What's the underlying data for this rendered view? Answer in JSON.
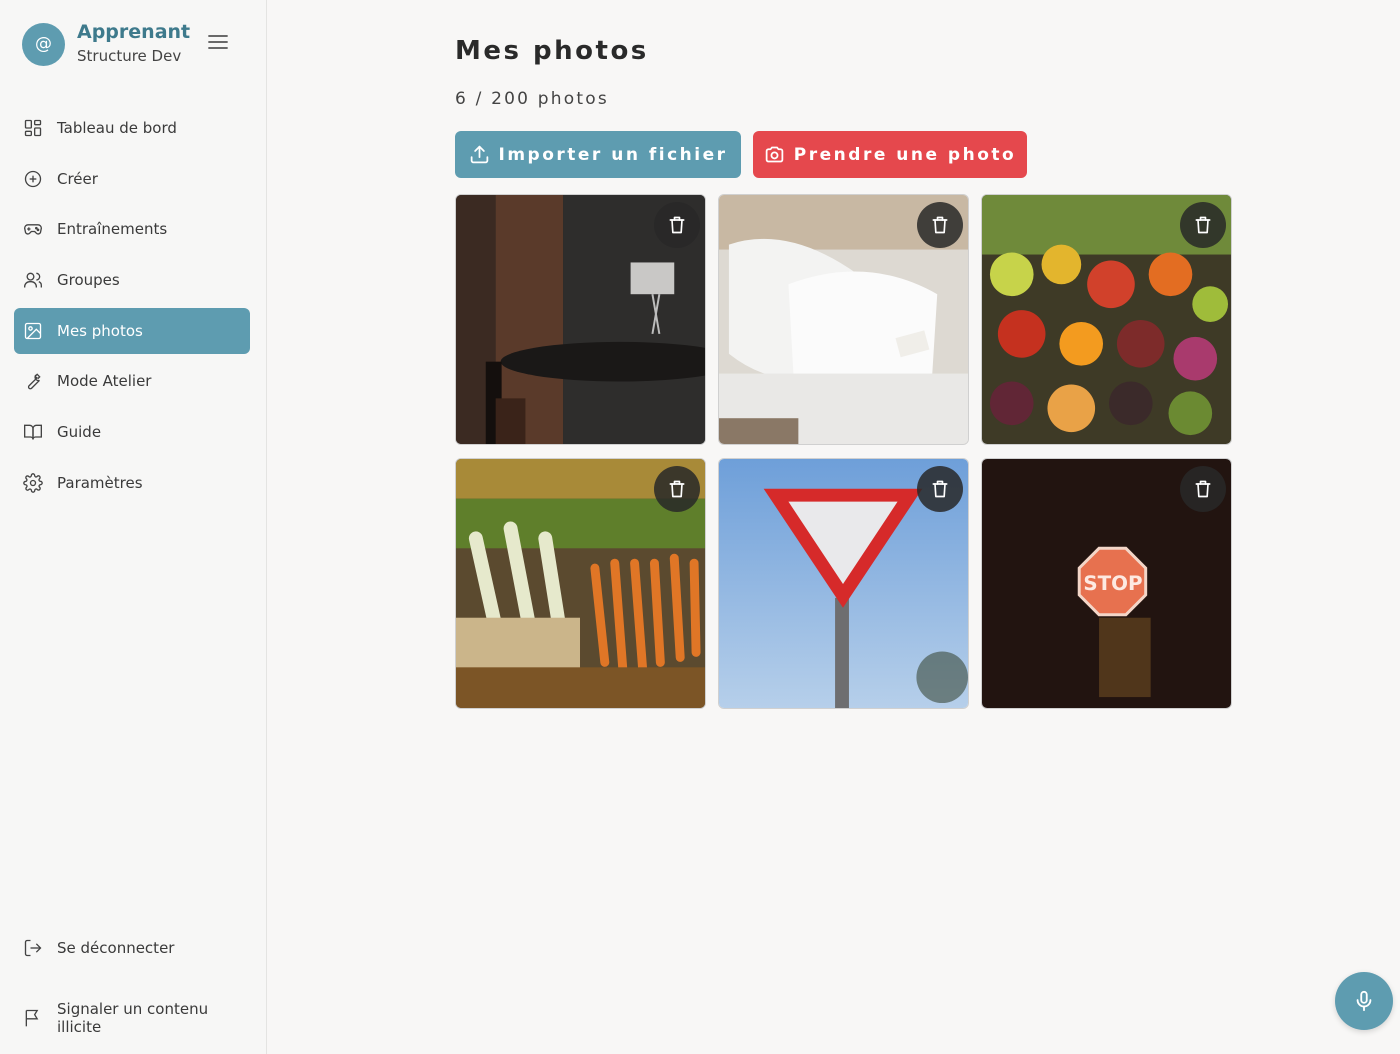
{
  "profile": {
    "avatar_symbol": "@",
    "name": "Apprenant",
    "subtitle": "Structure Dev"
  },
  "nav": {
    "items": [
      {
        "label": "Tableau de bord",
        "icon": "dashboard-icon"
      },
      {
        "label": "Créer",
        "icon": "plus-circle-icon"
      },
      {
        "label": "Entraînements",
        "icon": "gamepad-icon"
      },
      {
        "label": "Groupes",
        "icon": "users-icon"
      },
      {
        "label": "Mes photos",
        "icon": "image-icon",
        "active": true
      },
      {
        "label": "Mode Atelier",
        "icon": "wrench-icon"
      },
      {
        "label": "Guide",
        "icon": "book-icon"
      },
      {
        "label": "Paramètres",
        "icon": "gear-icon"
      }
    ],
    "logout_label": "Se déconnecter",
    "report_label_line1": "Signaler un contenu",
    "report_label_line2": "illicite"
  },
  "main": {
    "title": "Mes photos",
    "photo_count": "6 / 200 photos",
    "import_label": "Importer un fichier",
    "camera_label": "Prendre une photo"
  },
  "photos": [
    {
      "subject": "dark-room-with-table-and-lamp"
    },
    {
      "subject": "white-pillows-on-bed"
    },
    {
      "subject": "vegetable-market-stall"
    },
    {
      "subject": "leeks-and-carrots"
    },
    {
      "subject": "yield-road-sign"
    },
    {
      "subject": "stop-sign-at-night"
    }
  ],
  "colors": {
    "accent": "#5e9cb0",
    "danger": "#e5484d",
    "brand_text": "#3e7a8c"
  }
}
